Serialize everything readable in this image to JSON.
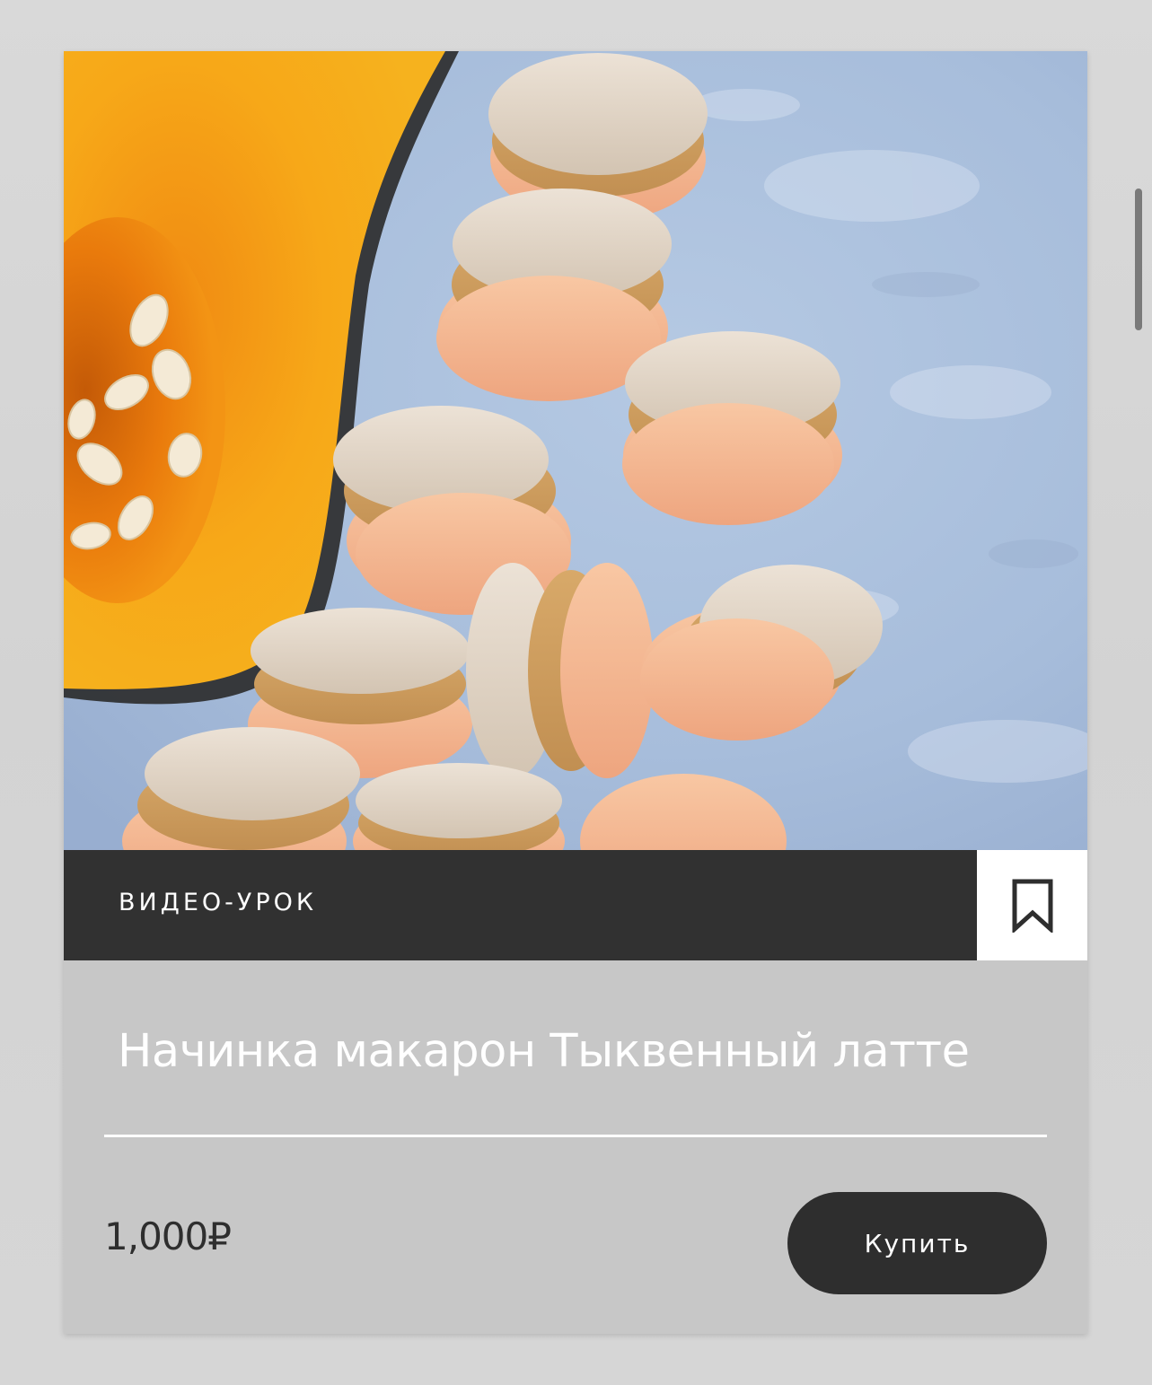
{
  "card": {
    "image_alt": "pumpkin-macarons-photo",
    "tag": "ВИДЕО-УРОК",
    "bookmark_icon": "bookmark-icon",
    "title": "Начинка макарон Тыквенный латте",
    "price": "1,000₽",
    "buy_label": "Купить"
  },
  "colors": {
    "tag_bar": "#313131",
    "card_bg": "#c7c7c7",
    "button_bg": "#2e2e2e",
    "text_light": "#ffffff",
    "text_dark": "#2e2e2e"
  }
}
